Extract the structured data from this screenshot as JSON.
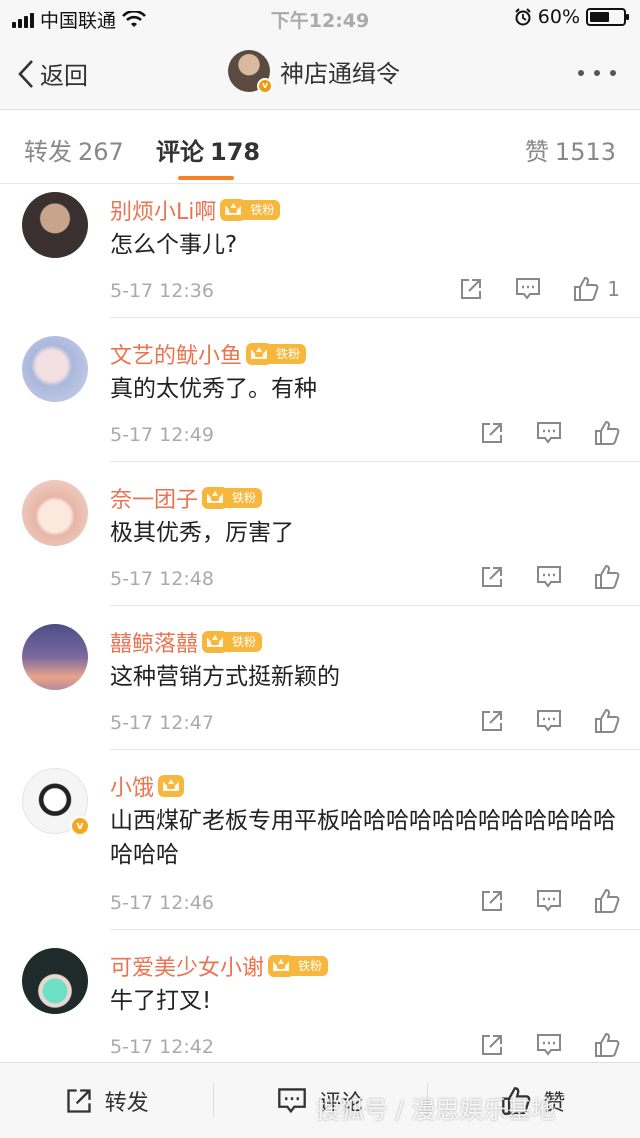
{
  "status_bar": {
    "carrier": "中国联通",
    "time": "下午12:49",
    "battery_percent": "60%",
    "battery_level": 0.6
  },
  "nav": {
    "back_label": "返回",
    "title": "神店通缉令"
  },
  "tabs": {
    "repost": {
      "label": "转发",
      "count": "267"
    },
    "comment": {
      "label": "评论",
      "count": "178"
    },
    "like": {
      "label": "赞",
      "count": "1513"
    }
  },
  "comments": [
    {
      "username": "别烦小Li啊",
      "badge": "铁粉",
      "text": "怎么个事儿?",
      "time": "5-17 12:36",
      "likes": "1",
      "avatar_color": "#3a3030"
    },
    {
      "username": "文艺的鱿小鱼",
      "badge": "铁粉",
      "text": "真的太优秀了。有种",
      "time": "5-17 12:49",
      "likes": "",
      "avatar_color": "#c9d3ea"
    },
    {
      "username": "奈一团子",
      "badge": "铁粉",
      "text": "极其优秀，厉害了",
      "time": "5-17 12:48",
      "likes": "",
      "avatar_color": "#f3d9cf"
    },
    {
      "username": "囍鲸落囍",
      "badge": "铁粉",
      "text": "这种营销方式挺新颖的",
      "time": "5-17 12:47",
      "likes": "",
      "avatar_color": "#6a5f9a"
    },
    {
      "username": "小饿",
      "badge": "",
      "text": "山西煤矿老板专用平板哈哈哈哈哈哈哈哈哈哈哈哈哈哈哈",
      "time": "5-17 12:46",
      "likes": "",
      "avatar_color": "#f1f1f1"
    },
    {
      "username": "可爱美少女小谢",
      "badge": "铁粉",
      "text": "牛了打叉!",
      "time": "5-17 12:42",
      "likes": "",
      "avatar_color": "#1f2a2a"
    }
  ],
  "toolbar": {
    "repost_label": "转发",
    "comment_label": "评论",
    "like_label": "赞"
  },
  "watermark": "搜狐号 / 漫思娱乐基地",
  "colors": {
    "accent": "#f58220",
    "username": "#eb7350",
    "badge": "#f6b73c"
  }
}
